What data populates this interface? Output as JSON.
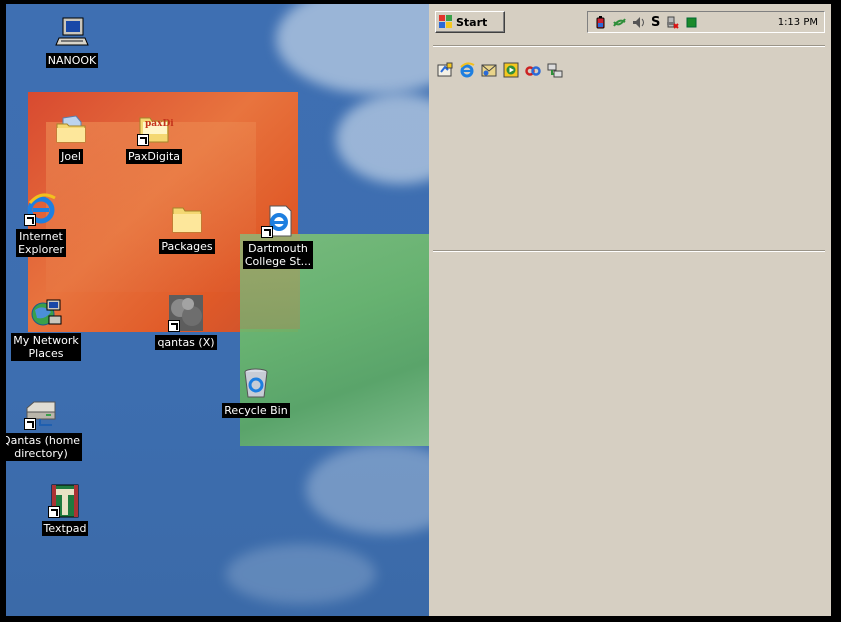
{
  "desktop": {
    "icons": [
      {
        "label": "NANOOK",
        "icon": "my-computer-icon"
      },
      {
        "label": "Joel",
        "icon": "user-folder-icon"
      },
      {
        "label": "PaxDigita",
        "icon": "folder-shortcut-icon"
      },
      {
        "label": "Internet\nExplorer",
        "icon": "internet-explorer-icon"
      },
      {
        "label": "Packages",
        "icon": "folder-icon"
      },
      {
        "label": "Dartmouth\nCollege St...",
        "icon": "ie-document-shortcut-icon"
      },
      {
        "label": "My Network\nPlaces",
        "icon": "network-places-icon"
      },
      {
        "label": "qantas (X)",
        "icon": "network-drive-shortcut-icon"
      },
      {
        "label": "Recycle Bin",
        "icon": "recycle-bin-icon"
      },
      {
        "label": "Qantas (home\ndirectory)",
        "icon": "home-drive-shortcut-icon"
      },
      {
        "label": "Textpad",
        "icon": "textpad-icon"
      }
    ],
    "folder_badge_text": "paxDi"
  },
  "taskbar": {
    "start_label": "Start",
    "tray_icons": [
      "battery-icon",
      "network-icon",
      "volume-icon",
      "s-letter-icon",
      "printer-error-icon",
      "green-status-icon"
    ],
    "tray_s_text": "S",
    "clock": "1:13 PM"
  },
  "quick_launch": {
    "icons": [
      "show-desktop-icon",
      "internet-explorer-icon",
      "outlook-icon",
      "media-player-icon",
      "link-icon",
      "connect-icon"
    ]
  },
  "colors": {
    "desktop_blue": "#3e6fb2",
    "panel_bg": "#d6cfc2",
    "label_bg": "#000000"
  }
}
